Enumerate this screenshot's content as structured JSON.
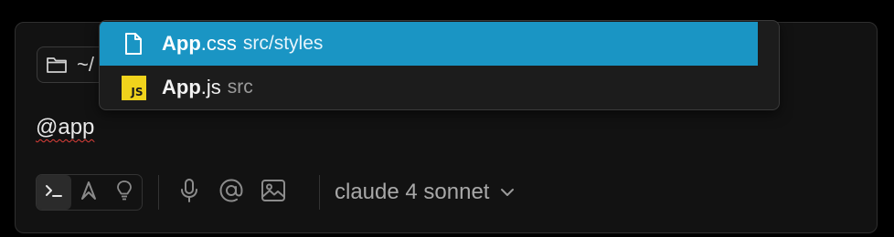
{
  "directory": {
    "text": "~/",
    "icon": "folder-icon"
  },
  "input": {
    "value": "@app"
  },
  "toolbar": {
    "modes": [
      {
        "icon": "terminal-icon",
        "active": true
      },
      {
        "icon": "agent-icon",
        "active": false
      },
      {
        "icon": "lightbulb-icon",
        "active": false
      }
    ],
    "tools": [
      "microphone-icon",
      "at-sign-icon",
      "image-icon"
    ],
    "model": {
      "label": "claude 4 sonnet",
      "icon": "chevron-down-icon"
    }
  },
  "suggestions": [
    {
      "name_match": "App",
      "name_rest": ".css",
      "path": "src/styles",
      "icon": "file-icon",
      "selected": true
    },
    {
      "name_match": "App",
      "name_rest": ".js",
      "path": "src",
      "icon": "js-icon",
      "badge": "JS",
      "selected": false
    }
  ],
  "colors": {
    "selection": "#1a95c4",
    "js_badge": "#f0d31c",
    "spellcheck": "#e0403a"
  }
}
